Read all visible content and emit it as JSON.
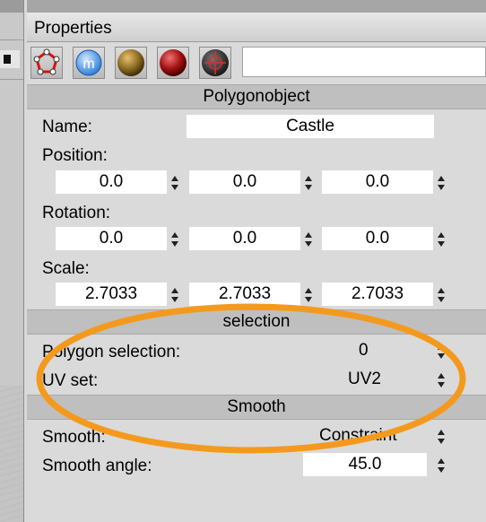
{
  "panel": {
    "title": "Properties"
  },
  "toolbar": {
    "icons": [
      "polygon-object-tag-icon",
      "material-m-icon",
      "bronze-material-icon",
      "red-material-icon",
      "dark-texture-material-icon"
    ]
  },
  "sections": {
    "polygonobject": "Polygonobject",
    "selection": "selection",
    "smooth": "Smooth"
  },
  "object": {
    "name_label": "Name:",
    "name_value": "Castle",
    "position_label": "Position:",
    "position": [
      "0.0",
      "0.0",
      "0.0"
    ],
    "rotation_label": "Rotation:",
    "rotation": [
      "0.0",
      "0.0",
      "0.0"
    ],
    "scale_label": "Scale:",
    "scale": [
      "2.7033",
      "2.7033",
      "2.7033"
    ]
  },
  "selection": {
    "polygon_selection_label": "Polygon selection:",
    "polygon_selection_value": "0",
    "uv_set_label": "UV set:",
    "uv_set_value": "UV2"
  },
  "smooth": {
    "smooth_label": "Smooth:",
    "smooth_value": "Constraint",
    "smooth_angle_label": "Smooth angle:",
    "smooth_angle_value": "45.0"
  },
  "colors": {
    "highlight": "#f39a1e",
    "header": "#bfbfbf",
    "panel": "#dadada"
  }
}
